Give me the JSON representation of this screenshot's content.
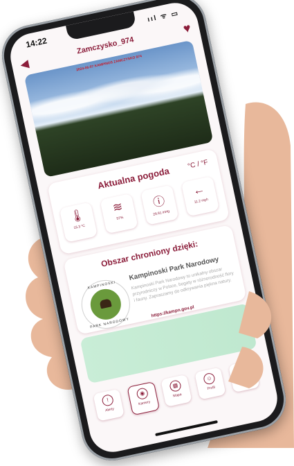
{
  "status": {
    "time": "14:22",
    "icons": "ııl ᯤ ▭"
  },
  "header": {
    "title": "Zamczysko_974",
    "back_icon": "◀",
    "favorite_icon": "♥"
  },
  "camera": {
    "stamp": "2024-06-07 KAMPINOS ZAMCZYSKO 974"
  },
  "weather": {
    "title": "Aktualna pogoda",
    "units": "°C / °F",
    "tiles": [
      {
        "icon": "🌡",
        "name": "temperature-icon",
        "value": "15.3 °C"
      },
      {
        "icon": "≋",
        "name": "humidity-icon",
        "value": "57%"
      },
      {
        "icon": "ⓘ",
        "name": "pressure-icon",
        "value": "29.91 inHg"
      },
      {
        "icon": "←",
        "name": "wind-arrow-icon",
        "value": "11.2 mph"
      }
    ]
  },
  "park": {
    "title": "Obszar chroniony dzięki:",
    "name": "Kampinoski Park Narodowy",
    "description": "Kampinoski Park Narodowy to unikalny obszar przyrodniczy w Polsce, bogaty w różnorodność flory i fauny. Zapraszamy do odkrywania piękna natury.",
    "link": "https://kampn.gov.pl",
    "logo_top": "KAMPINOSKI",
    "logo_bottom": "PARK NARODOWY"
  },
  "nav": {
    "items": [
      {
        "label": "Alerty",
        "icon": "!",
        "name": "nav-alerts"
      },
      {
        "label": "Kamery",
        "icon": "◉",
        "name": "nav-cameras",
        "active": true
      },
      {
        "label": "Mapa",
        "icon": "▦",
        "name": "nav-map"
      },
      {
        "label": "Profil",
        "icon": "☺",
        "name": "nav-profile"
      },
      {
        "label": "O aplikacji",
        "icon": "i",
        "name": "nav-about"
      }
    ]
  }
}
